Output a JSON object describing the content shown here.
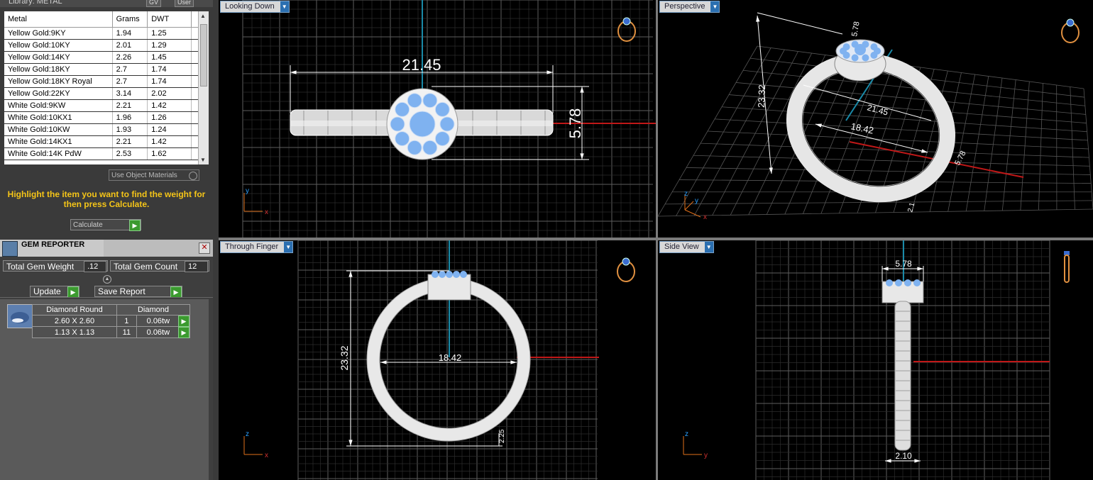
{
  "library": {
    "title": "Library: METAL",
    "gv_label": "GV",
    "user_label": "User",
    "columns": [
      "Metal",
      "Grams",
      "DWT"
    ],
    "rows": [
      {
        "metal": "Yellow Gold:9KY",
        "grams": "1.94",
        "dwt": "1.25"
      },
      {
        "metal": "Yellow Gold:10KY",
        "grams": "2.01",
        "dwt": "1.29"
      },
      {
        "metal": "Yellow Gold:14KY",
        "grams": "2.26",
        "dwt": "1.45"
      },
      {
        "metal": "Yellow Gold:18KY",
        "grams": "2.7",
        "dwt": "1.74"
      },
      {
        "metal": "Yellow Gold:18KY Royal",
        "grams": "2.7",
        "dwt": "1.74"
      },
      {
        "metal": "Yellow Gold:22KY",
        "grams": "3.14",
        "dwt": "2.02"
      },
      {
        "metal": "White Gold:9KW",
        "grams": "2.21",
        "dwt": "1.42"
      },
      {
        "metal": "White Gold:10KX1",
        "grams": "1.96",
        "dwt": "1.26"
      },
      {
        "metal": "White Gold:10KW",
        "grams": "1.93",
        "dwt": "1.24"
      },
      {
        "metal": "White Gold:14KX1",
        "grams": "2.21",
        "dwt": "1.42"
      },
      {
        "metal": "White Gold:14K PdW",
        "grams": "2.53",
        "dwt": "1.62"
      }
    ],
    "use_object_materials": "Use Object Materials",
    "hint": "Highlight the item you want to find the weight for then press Calculate.",
    "calculate_label": "Calculate"
  },
  "gem_reporter": {
    "title": "GEM REPORTER",
    "total_weight_label": "Total Gem Weight",
    "total_weight_value": ".12",
    "total_count_label": "Total Gem Count",
    "total_count_value": "12",
    "update_label": "Update",
    "save_report_label": "Save Report",
    "table_headers": [
      "Diamond Round",
      "Diamond"
    ],
    "table_rows": [
      {
        "size": "2.60 X 2.60",
        "count": "1",
        "weight": "0.06tw"
      },
      {
        "size": "1.13 X 1.13",
        "count": "11",
        "weight": "0.06tw"
      }
    ]
  },
  "viewports": {
    "top_left": {
      "label": "Looking Down",
      "dim_width": "21.45",
      "dim_height": "5.78",
      "axis_v": "y",
      "axis_h": "x"
    },
    "top_right": {
      "label": "Perspective",
      "dim_height": "23.32",
      "dim_width": "21.45",
      "dim_inner": "18.42",
      "dim_head": "5.78",
      "dim_shank": "5.78",
      "dim_small": "2.1",
      "axis_v": "z",
      "axis_a": "y",
      "axis_b": "x"
    },
    "bottom_left": {
      "label": "Through Finger",
      "dim_height": "23.32",
      "dim_inner": "18.42",
      "dim_small": "2.25",
      "axis_v": "z",
      "axis_h": "x"
    },
    "bottom_right": {
      "label": "Side View",
      "dim_head": "5.78",
      "dim_base": "2.10",
      "axis_v": "z",
      "axis_h": "y"
    }
  },
  "colors": {
    "grid": "#5a5a5a",
    "metal": "#e8e8e8",
    "gem": "#7fb2f0",
    "axis_red": "#c01818",
    "axis_cyan": "#1a8aa8",
    "hint": "#f5c518"
  }
}
